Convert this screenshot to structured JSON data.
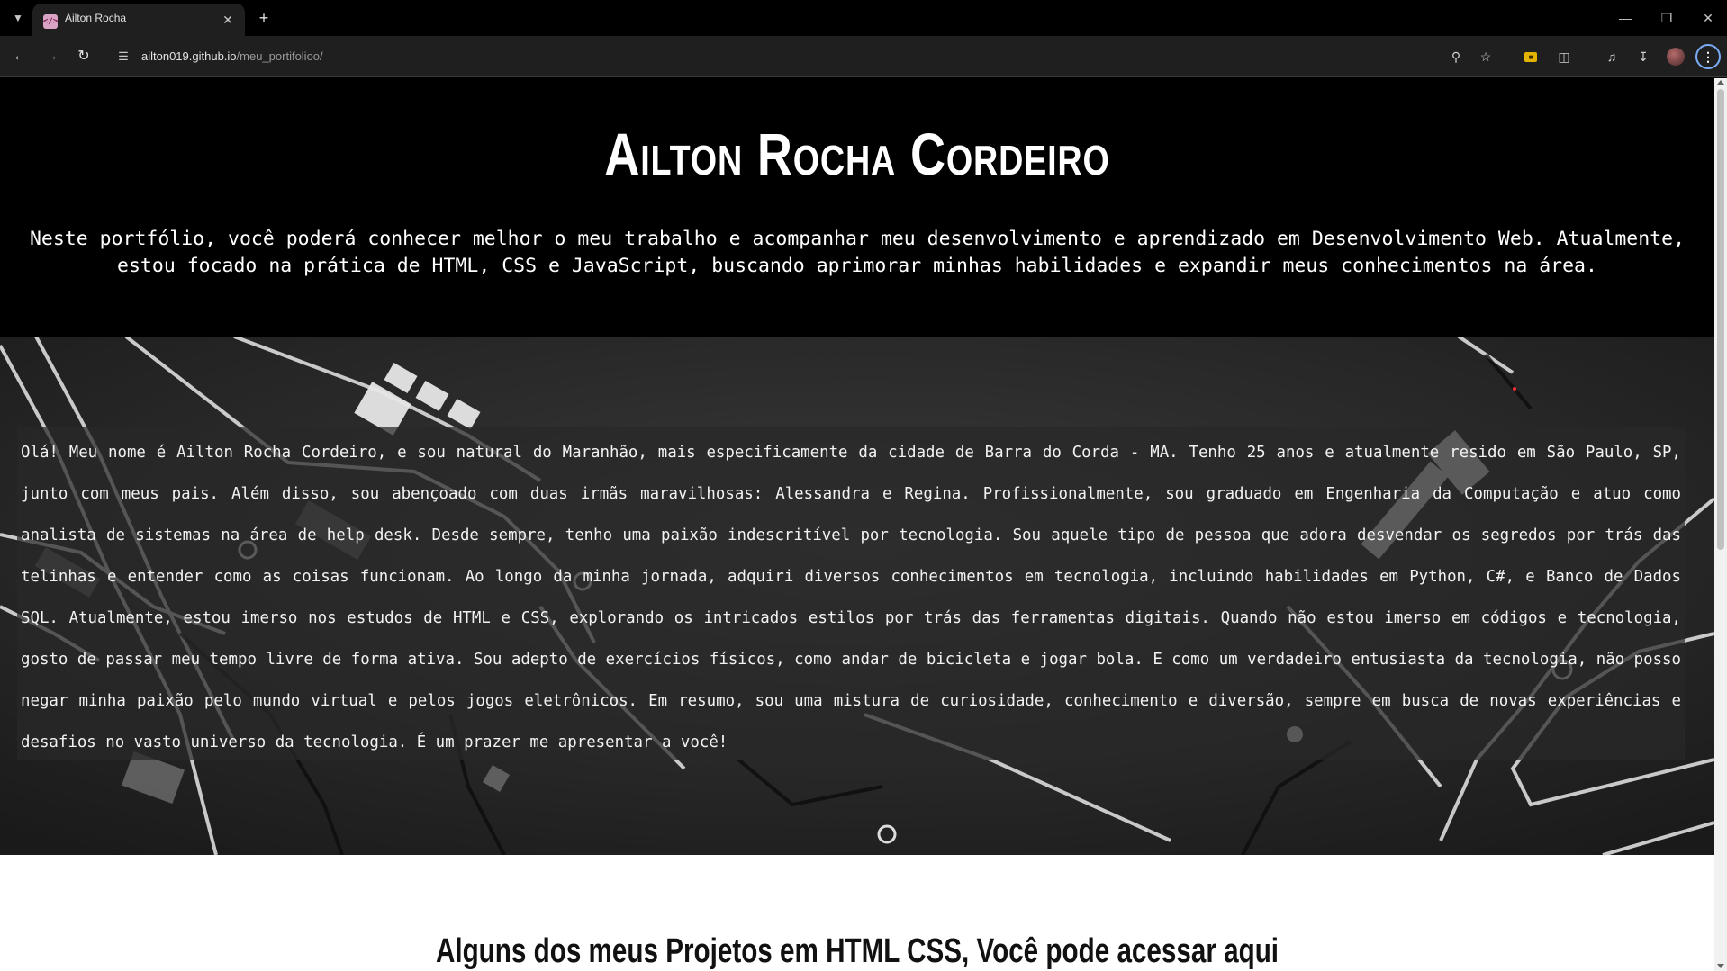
{
  "browser": {
    "tab": {
      "title": "Ailton Rocha",
      "favicon": "</>"
    },
    "url": {
      "host": "ailton019.github.io",
      "path": "/meu_portifolioo/"
    },
    "icons": {
      "tab_list": "chevron-down-icon",
      "close_tab": "close-icon",
      "new_tab": "plus-icon",
      "back": "arrow-left-icon",
      "forward": "arrow-right-icon",
      "reload": "reload-icon",
      "site_info": "tune-icon",
      "zoom": "zoom-icon",
      "bookmark": "star-icon",
      "extension": "extension-badge-icon",
      "extensions": "puzzle-icon",
      "media": "media-control-icon",
      "downloads": "download-icon",
      "profile": "avatar",
      "menu": "kebab-menu-icon"
    }
  },
  "page": {
    "name": "Ailton Rocha Cordeiro",
    "intro": "Neste portfólio, você poderá conhecer melhor o meu trabalho e acompanhar meu desenvolvimento e aprendizado em Desenvolvimento Web. Atualmente, estou focado na prática de HTML, CSS e JavaScript, buscando aprimorar minhas habilidades e expandir meus conhecimentos na área.",
    "about": "Olá! Meu nome é Ailton Rocha Cordeiro, e sou natural do Maranhão, mais especificamente da cidade de Barra do Corda - MA. Tenho 25 anos e atualmente resido em São Paulo, SP, junto com meus pais. Além disso, sou abençoado com duas irmãs maravilhosas: Alessandra e Regina. Profissionalmente, sou graduado em Engenharia da Computação e atuo como analista de sistemas na área de help desk. Desde sempre, tenho uma paixão indescritível por tecnologia. Sou aquele tipo de pessoa que adora desvendar os segredos por trás das telinhas e entender como as coisas funcionam. Ao longo da minha jornada, adquiri diversos conhecimentos em tecnologia, incluindo habilidades em Python, C#, e Banco de Dados SQL. Atualmente, estou imerso nos estudos de HTML e CSS, explorando os intricados estilos por trás das ferramentas digitais. Quando não estou imerso em códigos e tecnologia, gosto de passar meu tempo livre de forma ativa. Sou adepto de exercícios físicos, como andar de bicicleta e jogar bola. E como um verdadeiro entusiasta da tecnologia, não posso negar minha paixão pelo mundo virtual e pelos jogos eletrônicos. Em resumo, sou uma mistura de curiosidade, conhecimento e diversão, sempre em busca de novas experiências e desafios no vasto universo da tecnologia. É um prazer me apresentar a você!",
    "projects_title": "Alguns dos meus Projetos em HTML CSS, Você pode acessar aqui"
  },
  "colors": {
    "chrome_bg": "#000000",
    "toolbar_bg": "#1f1f1f",
    "header_bg": "#000000",
    "about_overlay": "#282828",
    "accent": "#7cacf8"
  }
}
